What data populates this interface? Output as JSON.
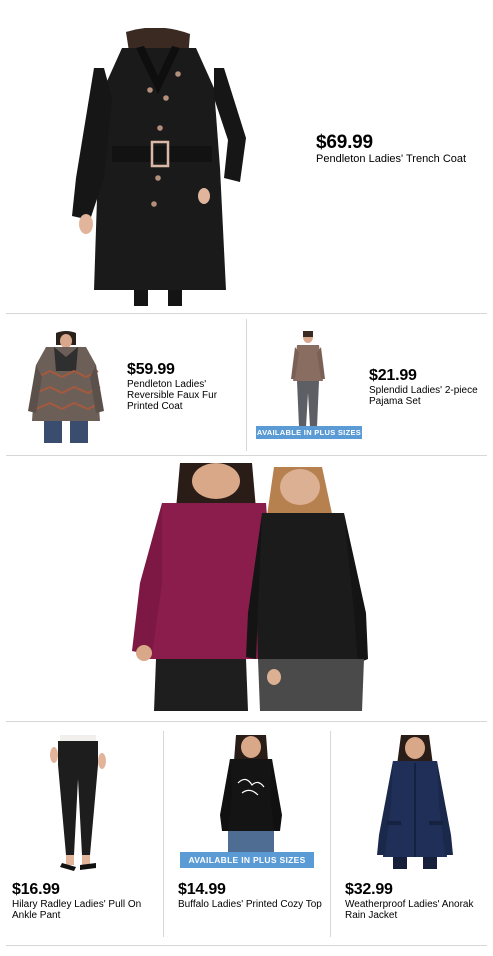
{
  "hero": {
    "price": "$69.99",
    "name": "Pendleton Ladies' Trench Coat"
  },
  "row2": {
    "left": {
      "price": "$59.99",
      "name": "Pendleton Ladies' Reversible Faux Fur Printed Coat"
    },
    "right": {
      "price": "$21.99",
      "name": "Splendid Ladies' 2-piece Pajama Set",
      "badge": "AVAILABLE IN PLUS SIZES"
    }
  },
  "row4": {
    "items": [
      {
        "price": "$16.99",
        "name": "Hilary Radley Ladies' Pull On Ankle Pant"
      },
      {
        "price": "$14.99",
        "name": "Buffalo Ladies' Printed Cozy Top",
        "badge": "AVAILABLE IN PLUS SIZES"
      },
      {
        "price": "$32.99",
        "name": "Weatherproof Ladies' Anorak Rain Jacket"
      }
    ]
  },
  "colors": {
    "badge_bg": "#5b9bd5",
    "divider": "#d7d7d7",
    "coat_black": "#1a1a1a",
    "magenta_top": "#8a1d4b",
    "navy_jacket": "#1f2f57"
  },
  "images": {
    "hero": "trench-coat-photo",
    "row2_left": "printed-coat-photo",
    "row2_right": "pajama-set-photo",
    "feature": "two-women-tops-photo",
    "row4_1": "ankle-pant-photo",
    "row4_2": "cozy-top-photo",
    "row4_3": "anorak-jacket-photo"
  }
}
